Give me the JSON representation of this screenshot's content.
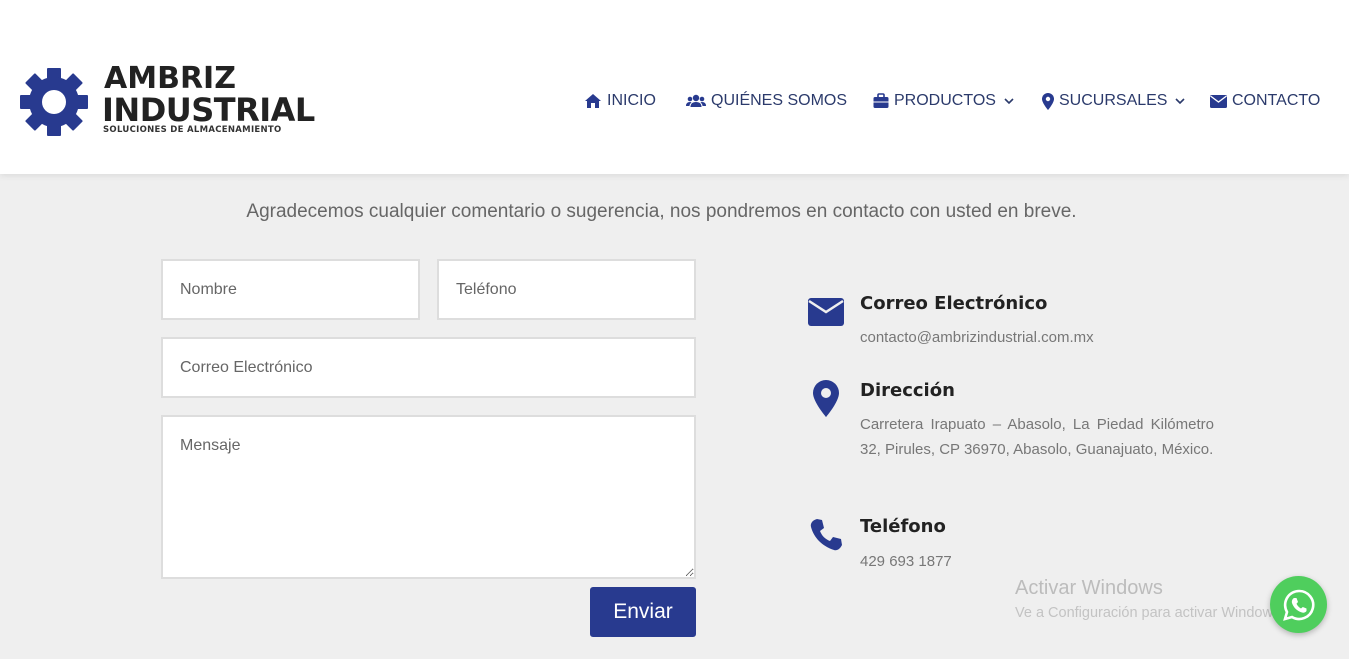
{
  "logo": {
    "line1": "AMBRIZ",
    "line2": "INDUSTRIAL",
    "tagline": "SOLUCIONES DE ALMACENAMIENTO"
  },
  "nav": {
    "items": [
      {
        "label": "INICIO",
        "icon": "home-icon"
      },
      {
        "label": "QUIÉNES SOMOS",
        "icon": "users-icon"
      },
      {
        "label": "PRODUCTOS",
        "icon": "briefcase-icon",
        "dropdown": true
      },
      {
        "label": "SUCURSALES",
        "icon": "map-marker-icon",
        "dropdown": true
      },
      {
        "label": "CONTACTO",
        "icon": "envelope-icon"
      }
    ]
  },
  "intro": "Agradecemos cualquier comentario o sugerencia, nos pondremos en contacto con usted en breve.",
  "form": {
    "name_placeholder": "Nombre",
    "phone_placeholder": "Teléfono",
    "email_placeholder": "Correo Electrónico",
    "message_placeholder": "Mensaje",
    "submit_label": "Enviar"
  },
  "contact": {
    "email_title": "Correo Electrónico",
    "email_value": "contacto@ambrizindustrial.com.mx",
    "address_title": "Dirección",
    "address_value": "Carretera Irapuato – Abasolo, La Piedad Kilómetro 32, Pirules, CP 36970, Abasolo, Guanajuato, México.",
    "phone_title": "Teléfono",
    "phone_value": "429 693 1877"
  },
  "watermark": {
    "line1": "Activar Windows",
    "line2": "Ve a Configuración para activar Windows."
  },
  "colors": {
    "brand_blue": "#283a8f",
    "nav_text": "#2b3a6b",
    "background": "#efefef",
    "whatsapp_green": "#4fce5d"
  }
}
